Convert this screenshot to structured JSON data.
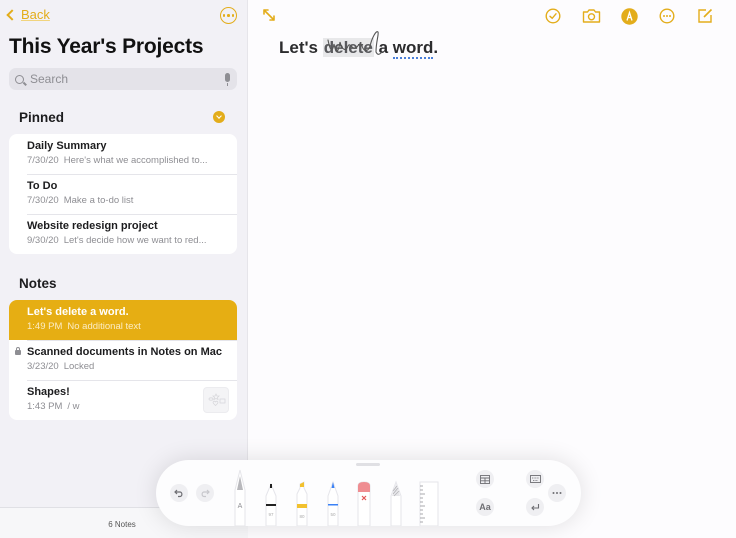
{
  "sidebar": {
    "back_label": "Back",
    "title": "This Year's Projects",
    "search_placeholder": "Search",
    "pinned_header": "Pinned",
    "notes_header": "Notes",
    "pinned": [
      {
        "title": "Daily Summary",
        "date": "7/30/20",
        "preview": "Here's what we accomplished to..."
      },
      {
        "title": "To Do",
        "date": "7/30/20",
        "preview": "Make a to-do list"
      },
      {
        "title": "Website redesign project",
        "date": "9/30/20",
        "preview": "Let's decide how we want to red..."
      }
    ],
    "notes": [
      {
        "title": "Let's delete a word.",
        "date": "1:49 PM",
        "preview": "No additional text",
        "selected": true
      },
      {
        "title": "Scanned documents in Notes on Mac",
        "date": "3/23/20",
        "preview": "Locked",
        "locked": true
      },
      {
        "title": "Shapes!",
        "date": "1:43 PM",
        "preview": "/ w",
        "has_thumbnail": true
      }
    ],
    "footer_count": "6 Notes"
  },
  "editor": {
    "text_before": "Let's ",
    "text_deleted": "delete",
    "text_middle": " a ",
    "text_word": "word",
    "text_end": ".",
    "top_icons": [
      "checklist-icon",
      "camera-icon",
      "markup-icon",
      "more-icon",
      "compose-icon"
    ]
  },
  "toolbar": {
    "tools": [
      {
        "name": "pen",
        "label": "A"
      },
      {
        "name": "marker",
        "size": "97",
        "color": "#222222"
      },
      {
        "name": "highlighter",
        "size": "80",
        "color": "#f2c12e"
      },
      {
        "name": "pencil",
        "size": "50",
        "color": "#3b82f6"
      },
      {
        "name": "eraser"
      },
      {
        "name": "lasso"
      },
      {
        "name": "ruler"
      }
    ],
    "text_style_label": "Aa"
  },
  "colors": {
    "accent": "#e3ad1b",
    "selected_row": "#e6ae13"
  }
}
